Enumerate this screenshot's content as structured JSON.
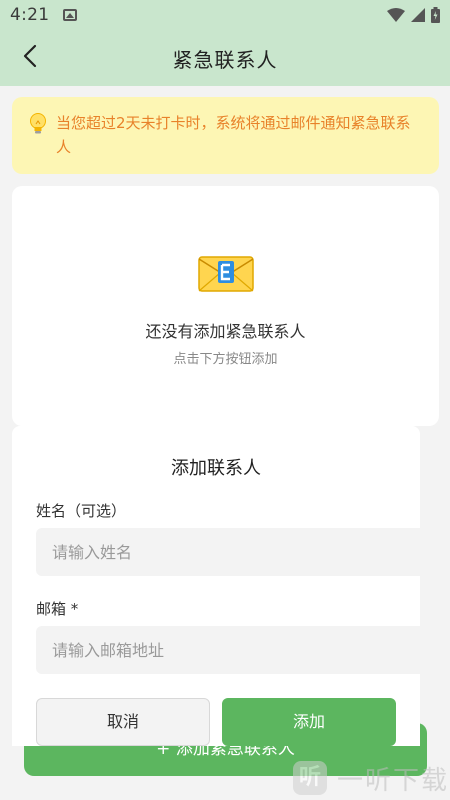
{
  "status_bar": {
    "time": "4:21"
  },
  "app_bar": {
    "title": "紧急联系人"
  },
  "notice": {
    "text": "当您超过2天未打卡时，系统将通过邮件通知紧急联系人"
  },
  "empty_state": {
    "title": "还没有添加紧急联系人",
    "subtitle": "点击下方按钮添加"
  },
  "background_button": {
    "label": "+ 添加紧急联系人"
  },
  "add_sheet": {
    "title": "添加联系人",
    "name_label": "姓名（可选）",
    "name_placeholder": "请输入姓名",
    "email_label": "邮箱 *",
    "email_placeholder": "请输入邮箱地址",
    "cancel_label": "取消",
    "confirm_label": "添加"
  },
  "watermark": {
    "logo": "听",
    "text": "一听下载"
  },
  "colors": {
    "header_bg": "#c9e6cd",
    "accent_green": "#5cb65f",
    "notice_bg": "#fdf6b4",
    "notice_text": "#e8822a"
  },
  "icons": [
    "back-arrow-icon",
    "image-icon",
    "wifi-icon",
    "signal-icon",
    "battery-icon",
    "lightbulb-icon",
    "envelope-icon"
  ]
}
